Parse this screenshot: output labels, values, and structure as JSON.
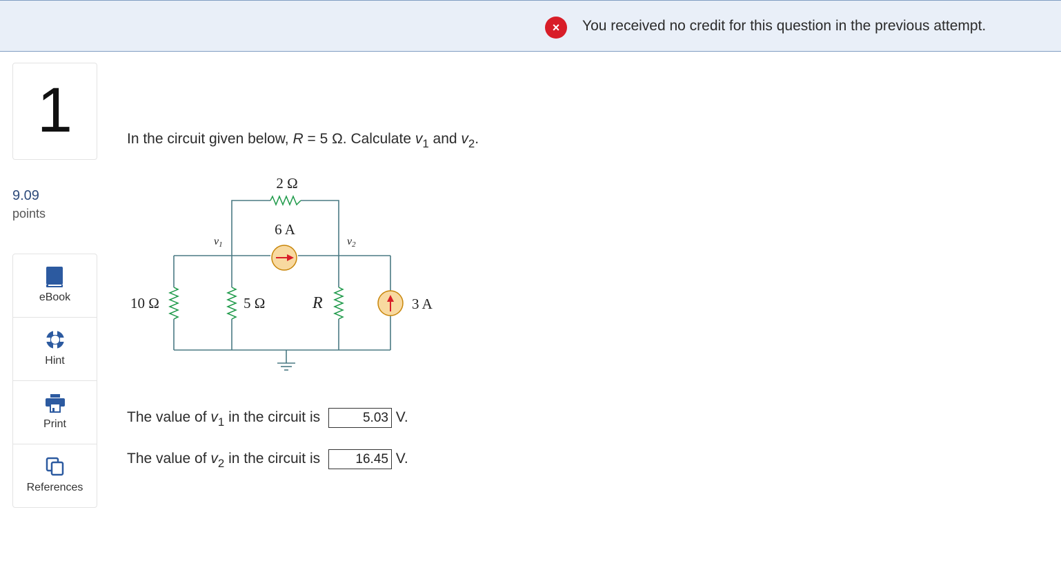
{
  "banner": {
    "icon": "x-circle-icon",
    "icon_glyph": "×",
    "message": "You received no credit for this question in the previous attempt."
  },
  "question_number": "1",
  "points": {
    "value": "9.09",
    "label": "points"
  },
  "tools": [
    {
      "icon": "book-icon",
      "label": "eBook"
    },
    {
      "icon": "lifebuoy-icon",
      "label": "Hint"
    },
    {
      "icon": "printer-icon",
      "label": "Print"
    },
    {
      "icon": "copy-icon",
      "label": "References"
    }
  ],
  "question": {
    "prefix": "In the circuit given below, ",
    "r_var": "R",
    "r_value": " = 5 Ω. Calculate ",
    "v1_var": "v",
    "v1_sub": "1",
    "and": " and ",
    "v2_var": "v",
    "v2_sub": "2",
    "suffix": "."
  },
  "circuit": {
    "r_top": "2 Ω",
    "i_top": "6 A",
    "v1_label": "v",
    "v1_sub": "1",
    "v2_label": "v",
    "v2_sub": "2",
    "r_left": "10 Ω",
    "r_mid": "5 Ω",
    "r_var": "R",
    "i_right": "3 A"
  },
  "answers": [
    {
      "prefix": "The value of ",
      "var": "v",
      "sub": "1",
      "middle": " in the circuit is ",
      "value": "5.03",
      "unit": " V."
    },
    {
      "prefix": "The value of ",
      "var": "v",
      "sub": "2",
      "middle": " in the circuit is ",
      "value": "16.45",
      "unit": " V."
    }
  ],
  "colors": {
    "banner_bg": "#e9eff8",
    "error_red": "#d81d28",
    "icon_blue": "#2c5aa0",
    "wire": "#4a7a84",
    "resistor": "#1f9a4a",
    "source_fill": "#f8d9a0",
    "source_arrow": "#d81d28"
  }
}
